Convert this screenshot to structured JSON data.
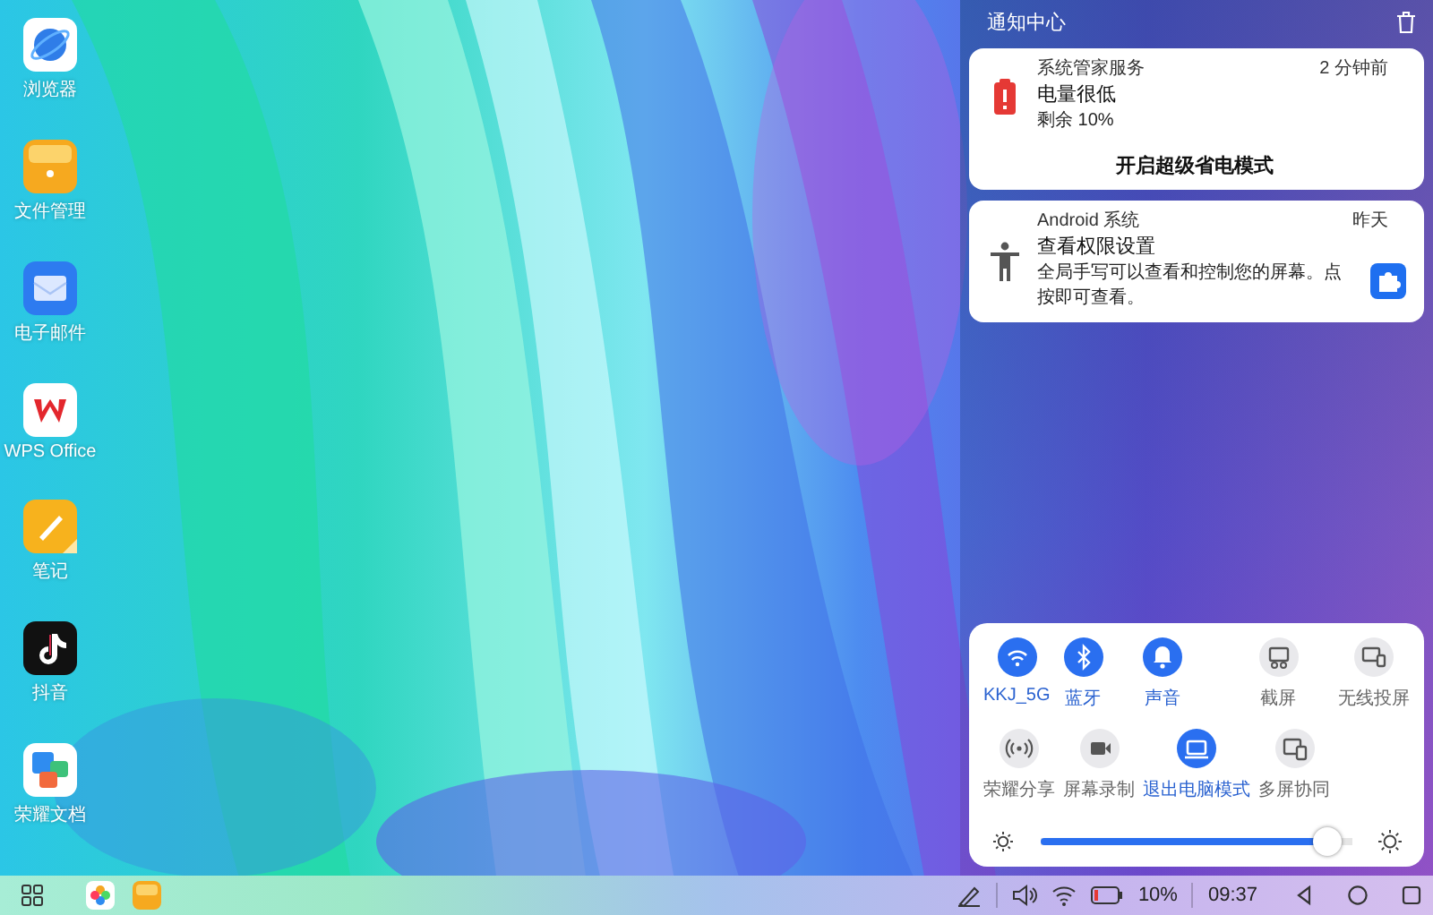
{
  "desktop_icons": [
    {
      "label": "浏览器",
      "kind": "browser"
    },
    {
      "label": "文件管理",
      "kind": "files"
    },
    {
      "label": "电子邮件",
      "kind": "email"
    },
    {
      "label": "WPS Office",
      "kind": "wps"
    },
    {
      "label": "笔记",
      "kind": "notes"
    },
    {
      "label": "抖音",
      "kind": "video"
    },
    {
      "label": "荣耀文档",
      "kind": "docs"
    }
  ],
  "notification_center": {
    "title": "通知中心",
    "notifications": [
      {
        "kind": "battery",
        "app": "系统管家服务",
        "time": "2 分钟前",
        "title": "电量很低",
        "body": "剩余 10%",
        "action": "开启超级省电模式"
      },
      {
        "kind": "accessibility",
        "app": "Android 系统",
        "time": "昨天",
        "title": "查看权限设置",
        "body": "全局手写可以查看和控制您的屏幕。点按即可查看。"
      }
    ]
  },
  "quick_settings": {
    "tiles": [
      {
        "kind": "wifi",
        "label": "KKJ_5G",
        "on": true
      },
      {
        "kind": "bluetooth",
        "label": "蓝牙",
        "on": true
      },
      {
        "kind": "sound",
        "label": "声音",
        "on": true
      },
      {
        "kind": "screenshot",
        "label": "截屏",
        "on": false
      },
      {
        "kind": "cast",
        "label": "无线投屏",
        "on": false
      },
      {
        "kind": "share",
        "label": "荣耀分享",
        "on": false
      },
      {
        "kind": "record",
        "label": "屏幕录制",
        "on": false
      },
      {
        "kind": "pc",
        "label": "退出电脑模式",
        "on": true
      },
      {
        "kind": "multiscreen",
        "label": "多屏协同",
        "on": false
      }
    ],
    "brightness": {
      "level": 0.92
    }
  },
  "taskbar": {
    "apps": [
      {
        "kind": "photos"
      },
      {
        "kind": "files"
      }
    ],
    "battery": "10%",
    "time": "09:37"
  }
}
